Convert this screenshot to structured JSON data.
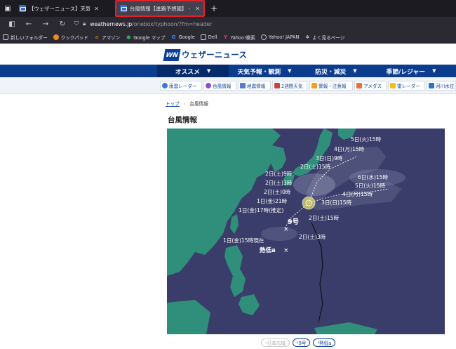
{
  "browser": {
    "tabs": [
      {
        "title": "【ウェザーニュース】天気 - 台風 - 地震",
        "active": false
      },
      {
        "title": "台風情報【進路予想図】 - ウェザ",
        "active": true
      }
    ],
    "url_host": "weathernews.jp",
    "url_path": "/onebox/typhoon/?fm=header",
    "bookmarks": [
      "新しいフォルダー",
      "クックパッド",
      "アマゾン",
      "Google マップ",
      "Google",
      "Dell",
      "Yahoo!検索",
      "Yahoo! JAPAN",
      "よく見るページ"
    ]
  },
  "site": {
    "logo_mark": "WN",
    "logo_text": "ウェザーニュース",
    "main_nav": [
      "オススメ",
      "天気予報・観測",
      "防災・減災",
      "季節/レジャー"
    ],
    "sub_nav": [
      "雨雲レーダー",
      "台風情報",
      "地震情報",
      "2週間天気",
      "警報・注意報",
      "アメダス",
      "雷レーダー",
      "河川水位"
    ],
    "breadcrumb": {
      "home": "トップ",
      "current": "台風情報"
    },
    "page_title": "台風情報"
  },
  "map": {
    "typhoon_name": "9号",
    "low_name": "熱低a",
    "labels": {
      "current": "1日(金)15時現在",
      "est": "1日(金)17時(推定)",
      "f1": "1日(金)21時",
      "f2a": "2日(土)0時",
      "f2b": "2日(土)3時",
      "f2c": "2日(土)9時",
      "f2d": "2日(土)15時",
      "f2e": "2日(土)15時",
      "f2f": "2日(土)3時",
      "f3a": "3日(日)9時",
      "f3b": "3日(日)15時",
      "f4a": "4日(月)15時",
      "f4b": "4日(月)15時",
      "f5a": "5日(火)15時",
      "f5b": "5日(火)15時",
      "f6": "6日(水)15時"
    }
  },
  "chips": [
    "日本広域",
    "9号",
    "熱低a"
  ],
  "colors": {
    "brand": "#0c3c8e",
    "sea": "#3a3d6a",
    "land": "#2f8f7a",
    "highlight": "#e0202a"
  }
}
